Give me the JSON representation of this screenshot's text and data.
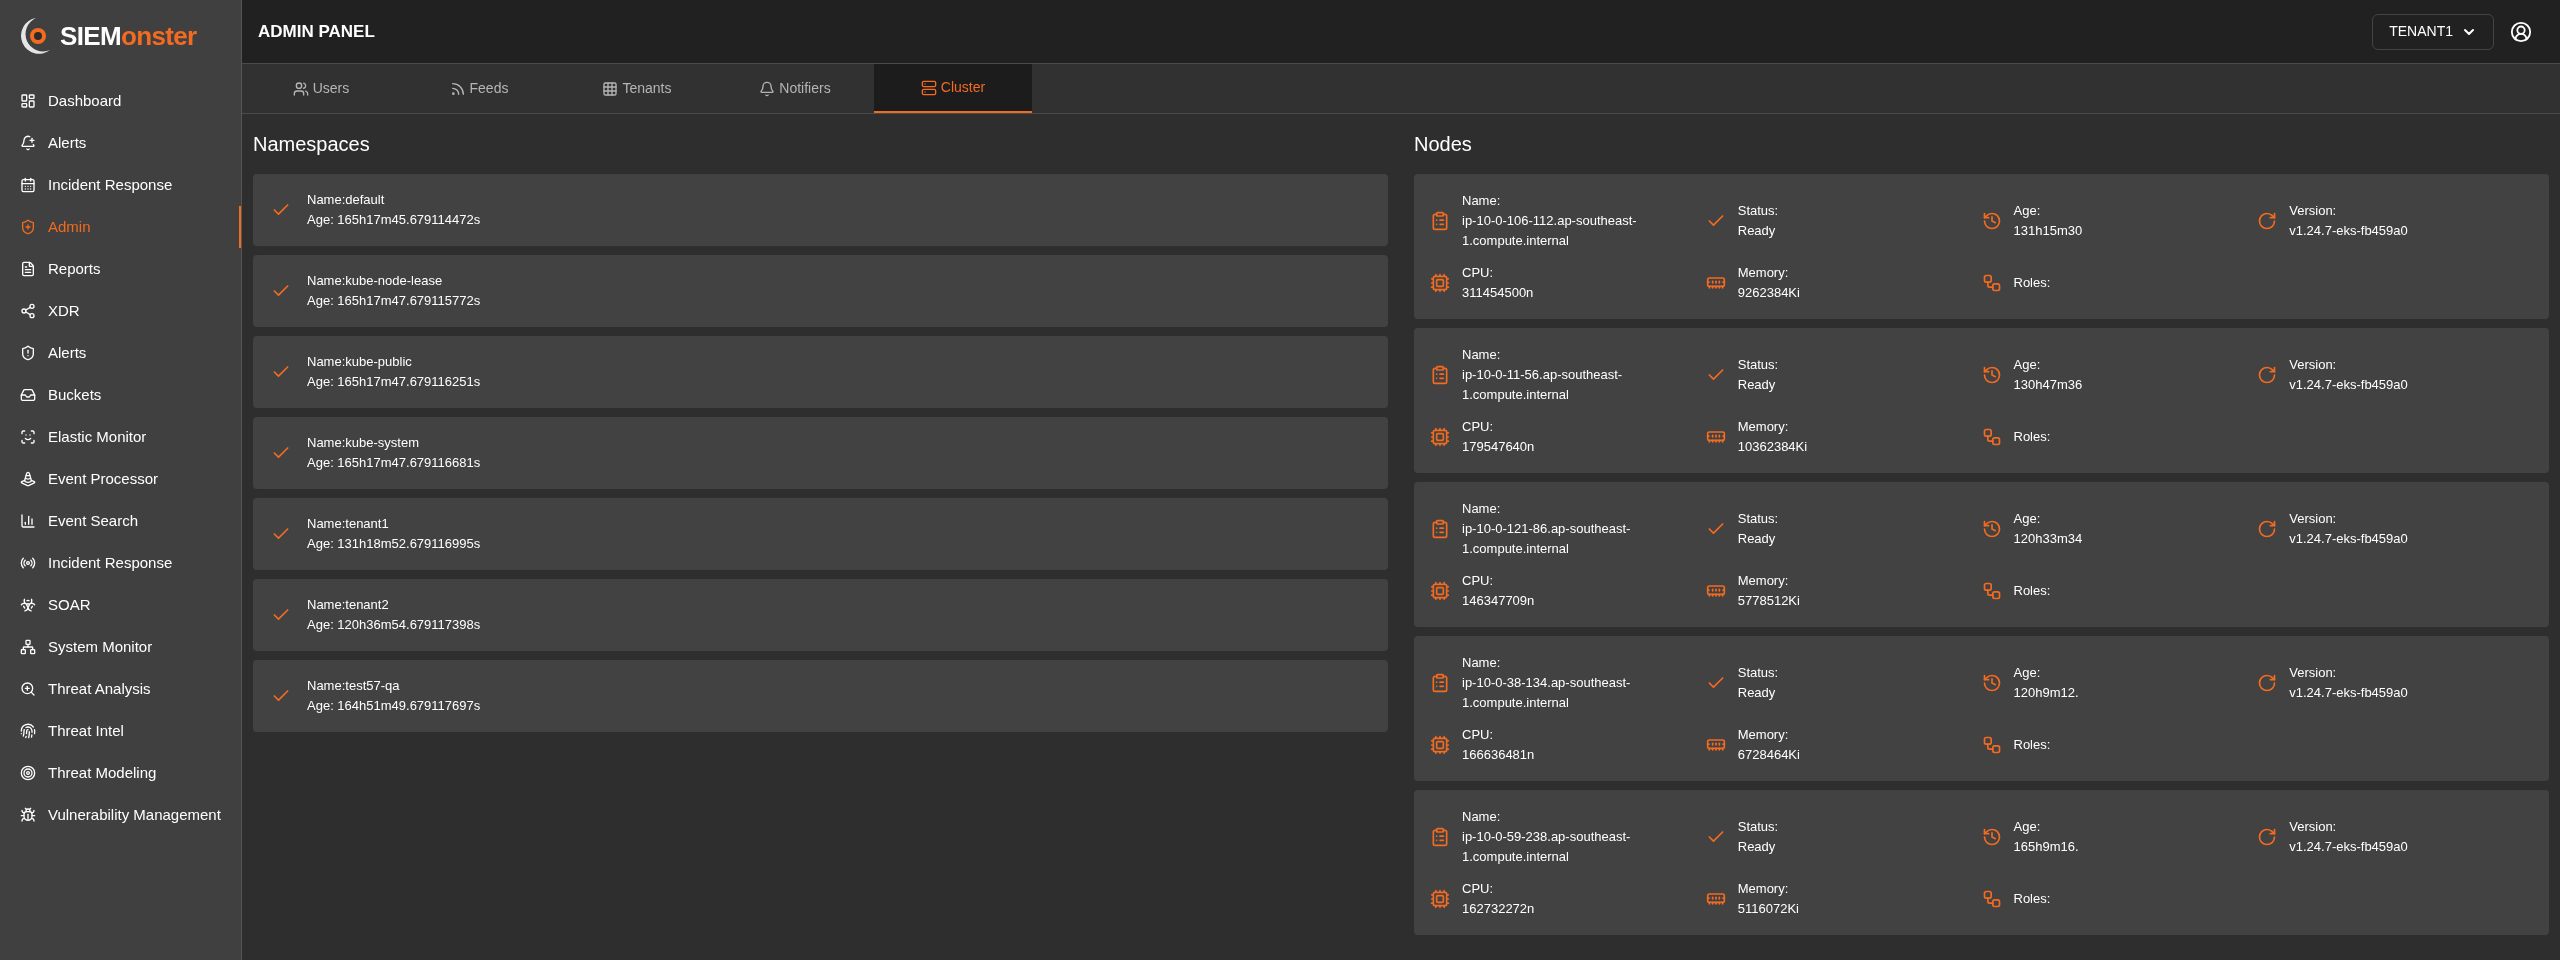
{
  "logo": {
    "prefix": "SIEM",
    "suffix": "onster"
  },
  "sidebar": {
    "items": [
      {
        "label": "Dashboard",
        "selected": false
      },
      {
        "label": "Alerts",
        "selected": false
      },
      {
        "label": "Incident Response",
        "selected": false
      },
      {
        "label": "Admin",
        "selected": true
      },
      {
        "label": "Reports",
        "selected": false
      },
      {
        "label": "XDR",
        "selected": false
      },
      {
        "label": "Alerts",
        "selected": false
      },
      {
        "label": "Buckets",
        "selected": false
      },
      {
        "label": "Elastic Monitor",
        "selected": false
      },
      {
        "label": "Event Processor",
        "selected": false
      },
      {
        "label": "Event Search",
        "selected": false
      },
      {
        "label": "Incident Response",
        "selected": false
      },
      {
        "label": "SOAR",
        "selected": false
      },
      {
        "label": "System Monitor",
        "selected": false
      },
      {
        "label": "Threat Analysis",
        "selected": false
      },
      {
        "label": "Threat Intel",
        "selected": false
      },
      {
        "label": "Threat Modeling",
        "selected": false
      },
      {
        "label": "Vulnerability Management",
        "selected": false
      }
    ]
  },
  "header": {
    "title": "ADMIN PANEL",
    "tenant": "TENANT1"
  },
  "tabs": [
    {
      "label": "Users",
      "selected": false
    },
    {
      "label": "Feeds",
      "selected": false
    },
    {
      "label": "Tenants",
      "selected": false
    },
    {
      "label": "Notifiers",
      "selected": false
    },
    {
      "label": "Cluster",
      "selected": true
    }
  ],
  "namespaces": {
    "title": "Namespaces",
    "items": [
      {
        "name": "Name:default",
        "age": "Age: 165h17m45.679114472s"
      },
      {
        "name": "Name:kube-node-lease",
        "age": "Age: 165h17m47.679115772s"
      },
      {
        "name": "Name:kube-public",
        "age": "Age: 165h17m47.679116251s"
      },
      {
        "name": "Name:kube-system",
        "age": "Age: 165h17m47.679116681s"
      },
      {
        "name": "Name:tenant1",
        "age": "Age: 131h18m52.679116995s"
      },
      {
        "name": "Name:tenant2",
        "age": "Age: 120h36m54.679117398s"
      },
      {
        "name": "Name:test57-qa",
        "age": "Age: 164h51m49.679117697s"
      }
    ]
  },
  "nodes": {
    "title": "Nodes",
    "items": [
      {
        "fields": [
          {
            "kind": "name",
            "label": "Name:",
            "value": "ip-10-0-106-112.ap-southeast-1.compute.internal"
          },
          {
            "kind": "status",
            "label": "Status:",
            "value": "Ready"
          },
          {
            "kind": "age",
            "label": "Age:",
            "value": "131h15m30"
          },
          {
            "kind": "version",
            "label": "Version:",
            "value": "v1.24.7-eks-fb459a0"
          },
          {
            "kind": "cpu",
            "label": "CPU:",
            "value": "311454500n"
          },
          {
            "kind": "memory",
            "label": "Memory:",
            "value": "9262384Ki"
          },
          {
            "kind": "roles",
            "label": "Roles:"
          }
        ]
      },
      {
        "fields": [
          {
            "kind": "name",
            "label": "Name:",
            "value": "ip-10-0-11-56.ap-southeast-1.compute.internal"
          },
          {
            "kind": "status",
            "label": "Status:",
            "value": "Ready"
          },
          {
            "kind": "age",
            "label": "Age:",
            "value": "130h47m36"
          },
          {
            "kind": "version",
            "label": "Version:",
            "value": "v1.24.7-eks-fb459a0"
          },
          {
            "kind": "cpu",
            "label": "CPU:",
            "value": "179547640n"
          },
          {
            "kind": "memory",
            "label": "Memory:",
            "value": "10362384Ki"
          },
          {
            "kind": "roles",
            "label": "Roles:"
          }
        ]
      },
      {
        "fields": [
          {
            "kind": "name",
            "label": "Name:",
            "value": "ip-10-0-121-86.ap-southeast-1.compute.internal"
          },
          {
            "kind": "status",
            "label": "Status:",
            "value": "Ready"
          },
          {
            "kind": "age",
            "label": "Age:",
            "value": "120h33m34"
          },
          {
            "kind": "version",
            "label": "Version:",
            "value": "v1.24.7-eks-fb459a0"
          },
          {
            "kind": "cpu",
            "label": "CPU:",
            "value": "146347709n"
          },
          {
            "kind": "memory",
            "label": "Memory:",
            "value": "5778512Ki"
          },
          {
            "kind": "roles",
            "label": "Roles:"
          }
        ]
      },
      {
        "fields": [
          {
            "kind": "name",
            "label": "Name:",
            "value": "ip-10-0-38-134.ap-southeast-1.compute.internal"
          },
          {
            "kind": "status",
            "label": "Status:",
            "value": "Ready"
          },
          {
            "kind": "age",
            "label": "Age:",
            "value": "120h9m12."
          },
          {
            "kind": "version",
            "label": "Version:",
            "value": "v1.24.7-eks-fb459a0"
          },
          {
            "kind": "cpu",
            "label": "CPU:",
            "value": "166636481n"
          },
          {
            "kind": "memory",
            "label": "Memory:",
            "value": "6728464Ki"
          },
          {
            "kind": "roles",
            "label": "Roles:"
          }
        ]
      },
      {
        "fields": [
          {
            "kind": "name",
            "label": "Name:",
            "value": "ip-10-0-59-238.ap-southeast-1.compute.internal"
          },
          {
            "kind": "status",
            "label": "Status:",
            "value": "Ready"
          },
          {
            "kind": "age",
            "label": "Age:",
            "value": "165h9m16."
          },
          {
            "kind": "version",
            "label": "Version:",
            "value": "v1.24.7-eks-fb459a0"
          },
          {
            "kind": "cpu",
            "label": "CPU:",
            "value": "162732272n"
          },
          {
            "kind": "memory",
            "label": "Memory:",
            "value": "5116072Ki"
          },
          {
            "kind": "roles",
            "label": "Roles:"
          }
        ]
      }
    ]
  }
}
